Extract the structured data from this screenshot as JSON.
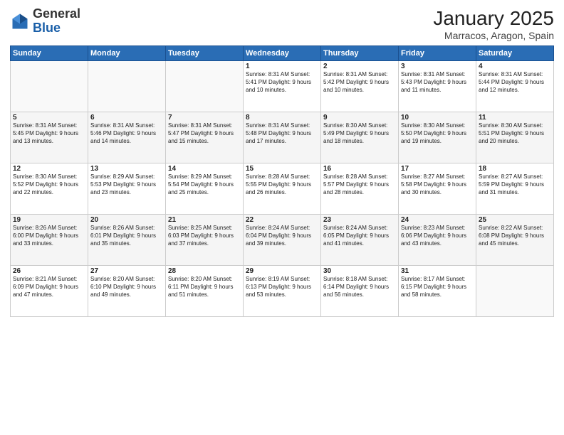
{
  "header": {
    "logo_general": "General",
    "logo_blue": "Blue",
    "month_year": "January 2025",
    "location": "Marracos, Aragon, Spain"
  },
  "weekdays": [
    "Sunday",
    "Monday",
    "Tuesday",
    "Wednesday",
    "Thursday",
    "Friday",
    "Saturday"
  ],
  "weeks": [
    [
      {
        "day": "",
        "content": ""
      },
      {
        "day": "",
        "content": ""
      },
      {
        "day": "",
        "content": ""
      },
      {
        "day": "1",
        "content": "Sunrise: 8:31 AM\nSunset: 5:41 PM\nDaylight: 9 hours\nand 10 minutes."
      },
      {
        "day": "2",
        "content": "Sunrise: 8:31 AM\nSunset: 5:42 PM\nDaylight: 9 hours\nand 10 minutes."
      },
      {
        "day": "3",
        "content": "Sunrise: 8:31 AM\nSunset: 5:43 PM\nDaylight: 9 hours\nand 11 minutes."
      },
      {
        "day": "4",
        "content": "Sunrise: 8:31 AM\nSunset: 5:44 PM\nDaylight: 9 hours\nand 12 minutes."
      }
    ],
    [
      {
        "day": "5",
        "content": "Sunrise: 8:31 AM\nSunset: 5:45 PM\nDaylight: 9 hours\nand 13 minutes."
      },
      {
        "day": "6",
        "content": "Sunrise: 8:31 AM\nSunset: 5:46 PM\nDaylight: 9 hours\nand 14 minutes."
      },
      {
        "day": "7",
        "content": "Sunrise: 8:31 AM\nSunset: 5:47 PM\nDaylight: 9 hours\nand 15 minutes."
      },
      {
        "day": "8",
        "content": "Sunrise: 8:31 AM\nSunset: 5:48 PM\nDaylight: 9 hours\nand 17 minutes."
      },
      {
        "day": "9",
        "content": "Sunrise: 8:30 AM\nSunset: 5:49 PM\nDaylight: 9 hours\nand 18 minutes."
      },
      {
        "day": "10",
        "content": "Sunrise: 8:30 AM\nSunset: 5:50 PM\nDaylight: 9 hours\nand 19 minutes."
      },
      {
        "day": "11",
        "content": "Sunrise: 8:30 AM\nSunset: 5:51 PM\nDaylight: 9 hours\nand 20 minutes."
      }
    ],
    [
      {
        "day": "12",
        "content": "Sunrise: 8:30 AM\nSunset: 5:52 PM\nDaylight: 9 hours\nand 22 minutes."
      },
      {
        "day": "13",
        "content": "Sunrise: 8:29 AM\nSunset: 5:53 PM\nDaylight: 9 hours\nand 23 minutes."
      },
      {
        "day": "14",
        "content": "Sunrise: 8:29 AM\nSunset: 5:54 PM\nDaylight: 9 hours\nand 25 minutes."
      },
      {
        "day": "15",
        "content": "Sunrise: 8:28 AM\nSunset: 5:55 PM\nDaylight: 9 hours\nand 26 minutes."
      },
      {
        "day": "16",
        "content": "Sunrise: 8:28 AM\nSunset: 5:57 PM\nDaylight: 9 hours\nand 28 minutes."
      },
      {
        "day": "17",
        "content": "Sunrise: 8:27 AM\nSunset: 5:58 PM\nDaylight: 9 hours\nand 30 minutes."
      },
      {
        "day": "18",
        "content": "Sunrise: 8:27 AM\nSunset: 5:59 PM\nDaylight: 9 hours\nand 31 minutes."
      }
    ],
    [
      {
        "day": "19",
        "content": "Sunrise: 8:26 AM\nSunset: 6:00 PM\nDaylight: 9 hours\nand 33 minutes."
      },
      {
        "day": "20",
        "content": "Sunrise: 8:26 AM\nSunset: 6:01 PM\nDaylight: 9 hours\nand 35 minutes."
      },
      {
        "day": "21",
        "content": "Sunrise: 8:25 AM\nSunset: 6:03 PM\nDaylight: 9 hours\nand 37 minutes."
      },
      {
        "day": "22",
        "content": "Sunrise: 8:24 AM\nSunset: 6:04 PM\nDaylight: 9 hours\nand 39 minutes."
      },
      {
        "day": "23",
        "content": "Sunrise: 8:24 AM\nSunset: 6:05 PM\nDaylight: 9 hours\nand 41 minutes."
      },
      {
        "day": "24",
        "content": "Sunrise: 8:23 AM\nSunset: 6:06 PM\nDaylight: 9 hours\nand 43 minutes."
      },
      {
        "day": "25",
        "content": "Sunrise: 8:22 AM\nSunset: 6:08 PM\nDaylight: 9 hours\nand 45 minutes."
      }
    ],
    [
      {
        "day": "26",
        "content": "Sunrise: 8:21 AM\nSunset: 6:09 PM\nDaylight: 9 hours\nand 47 minutes."
      },
      {
        "day": "27",
        "content": "Sunrise: 8:20 AM\nSunset: 6:10 PM\nDaylight: 9 hours\nand 49 minutes."
      },
      {
        "day": "28",
        "content": "Sunrise: 8:20 AM\nSunset: 6:11 PM\nDaylight: 9 hours\nand 51 minutes."
      },
      {
        "day": "29",
        "content": "Sunrise: 8:19 AM\nSunset: 6:13 PM\nDaylight: 9 hours\nand 53 minutes."
      },
      {
        "day": "30",
        "content": "Sunrise: 8:18 AM\nSunset: 6:14 PM\nDaylight: 9 hours\nand 56 minutes."
      },
      {
        "day": "31",
        "content": "Sunrise: 8:17 AM\nSunset: 6:15 PM\nDaylight: 9 hours\nand 58 minutes."
      },
      {
        "day": "",
        "content": ""
      }
    ]
  ]
}
